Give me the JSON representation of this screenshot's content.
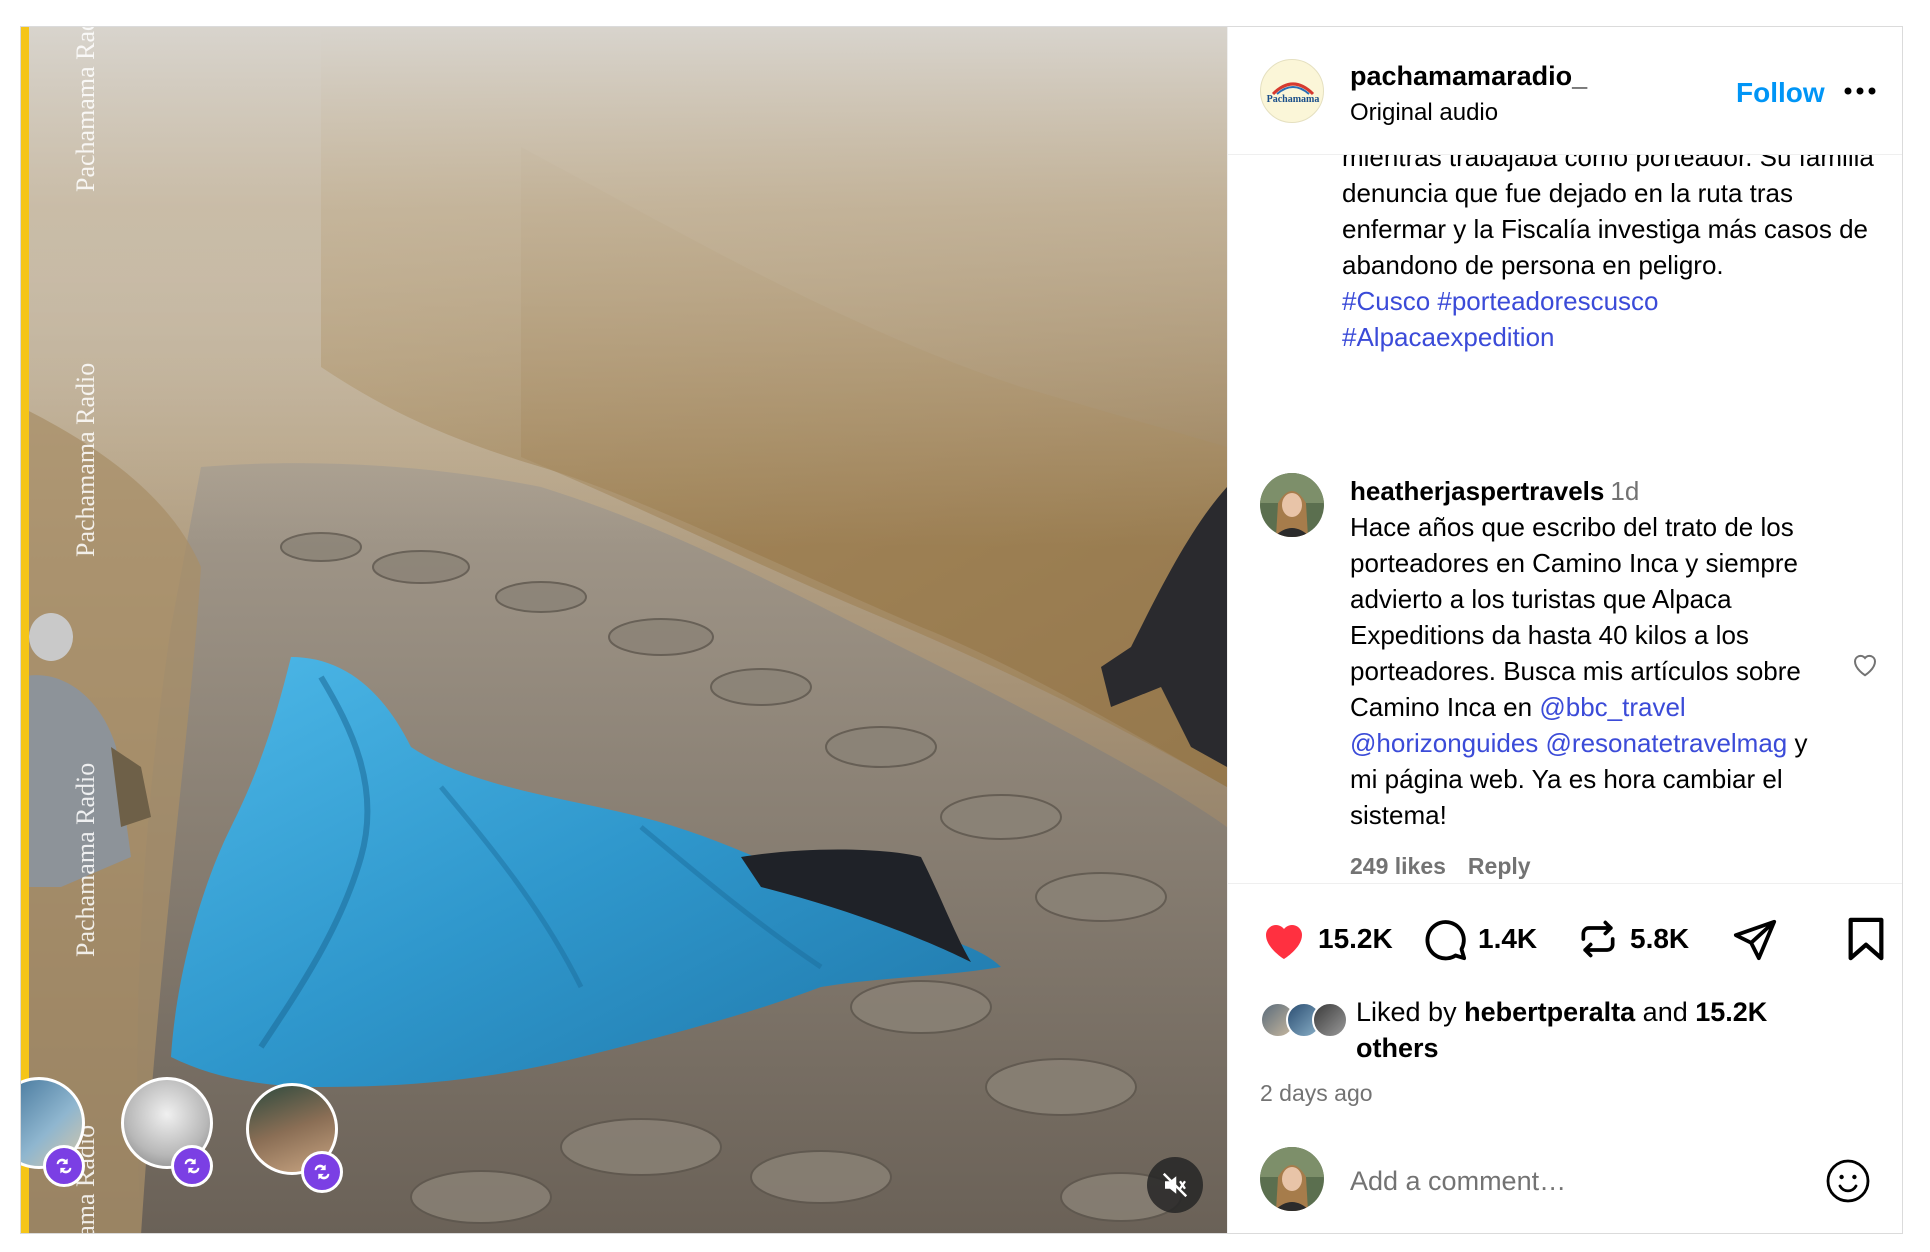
{
  "post": {
    "username": "pachamamaradio_",
    "audio": "Original audio",
    "follow_label": "Follow",
    "more_icon": "more-options-icon",
    "header_avatar_text": "Pachamama"
  },
  "media": {
    "watermark": "Pachamama Radio",
    "watermark_partial": "mama Radio",
    "mute_icon": "muted-speaker-icon",
    "repost_icon": "repost-icon"
  },
  "caption": {
    "text": "mientras trabajaba como porteador. Su familia denuncia que fue dejado en la ruta tras enfermar y la Fiscalía investiga más casos de abandono de persona en peligro.",
    "hashtags_line1": "#Cusco #porteadorescusco",
    "hashtags_line2": "#Alpacaexpedition"
  },
  "comment": {
    "username": "heatherjaspertravels",
    "time": "1d",
    "text_before": "Hace años que escribo del trato de los porteadores en Camino Inca y siempre advierto a los turistas que Alpaca Expeditions da hasta 40 kilos a los porteadores. Busca mis artículos sobre Camino Inca en",
    "mention1": "@bbc_travel",
    "mention2": "@horizonguides",
    "mention3": "@resonatetravelmag",
    "text_after": "y mi página web. Ya es hora cambiar el sistema!",
    "likes": "249 likes",
    "reply_label": "Reply"
  },
  "actions": {
    "like_count": "15.2K",
    "comment_count": "1.4K",
    "repost_count": "5.8K",
    "liked_by_prefix": "Liked by",
    "liked_by_user": "hebertperalta",
    "liked_by_and": "and",
    "liked_by_others": "15.2K others",
    "time_ago": "2 days ago"
  },
  "add_comment": {
    "placeholder": "Add a comment…"
  },
  "colors": {
    "link": "#3b4bd8",
    "follow": "#0095f6",
    "like_red": "#ff3040",
    "repost_badge": "#7b3fe4",
    "tarp_blue": "#3aa6d9",
    "side_strip": "#f5c518"
  }
}
